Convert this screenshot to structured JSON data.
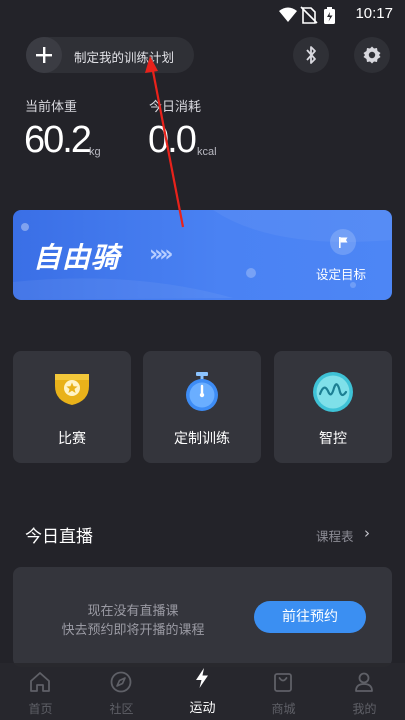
{
  "status_bar": {
    "time": "10:17"
  },
  "header": {
    "plan_label": "制定我的训练计划"
  },
  "stats": [
    {
      "label": "当前体重",
      "value": "60.2",
      "unit": "kg"
    },
    {
      "label": "今日消耗",
      "value": "0.0",
      "unit": "kcal"
    }
  ],
  "ride_card": {
    "title": "自由骑",
    "chevrons": "»»",
    "goal_label": "设定目标"
  },
  "tiles": [
    {
      "label": "比赛",
      "icon": "trophy-icon"
    },
    {
      "label": "定制训练",
      "icon": "stopwatch-icon"
    },
    {
      "label": "智控",
      "icon": "wave-icon"
    }
  ],
  "live": {
    "title": "今日直播",
    "schedule_link": "课程表",
    "empty_line1": "现在没有直播课",
    "empty_line2": "快去预约即将开播的课程",
    "book_button": "前往预约"
  },
  "nav": [
    {
      "label": "首页",
      "icon": "home-icon",
      "active": false
    },
    {
      "label": "社区",
      "icon": "compass-icon",
      "active": false
    },
    {
      "label": "运动",
      "icon": "lightning-icon",
      "active": true
    },
    {
      "label": "商城",
      "icon": "bag-icon",
      "active": false
    },
    {
      "label": "我的",
      "icon": "person-icon",
      "active": false
    }
  ],
  "colors": {
    "background": "#232329",
    "card": "#34353c",
    "accent_blue": "#3b8ff2",
    "ride_card_blue": "#4a82f3",
    "annotation_red": "#e8221b"
  }
}
